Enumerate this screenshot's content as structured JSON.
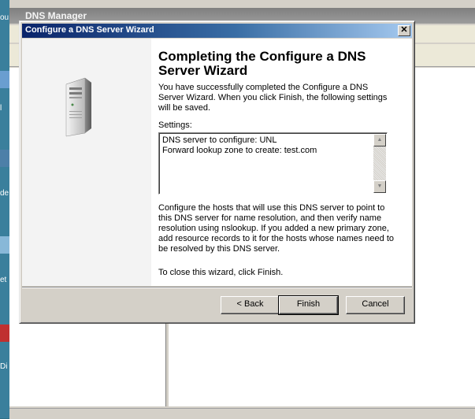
{
  "background_app": {
    "title": "DNS Manager",
    "desktop_labels": [
      "ou",
      "l",
      "de",
      "et",
      "Di"
    ]
  },
  "wizard": {
    "window_title": "Configure a DNS Server Wizard",
    "close_glyph": "✕",
    "heading": "Completing the Configure a DNS Server Wizard",
    "intro": "You have successfully completed the Configure a DNS Server Wizard. When you click Finish, the following settings will be saved.",
    "settings_label": "Settings:",
    "settings_lines": [
      "DNS server to configure: UNL",
      "Forward lookup zone to create: test.com"
    ],
    "instructions": "Configure the hosts that will use this DNS server to point to this DNS server for name resolution, and then verify name resolution using nslookup. If you added a new primary zone, add resource records to it for the hosts whose names need to be resolved by this DNS server.",
    "close_note": "To close this wizard, click Finish.",
    "buttons": {
      "back": "< Back",
      "finish": "Finish",
      "cancel": "Cancel"
    },
    "icons": {
      "server": "server-tower-icon",
      "scroll_up": "scroll-up-arrow-icon",
      "scroll_down": "scroll-down-arrow-icon"
    }
  },
  "colors": {
    "title_bar_start": "#0a246a",
    "title_bar_end": "#a6caf0",
    "dialog_face": "#d4d0c8",
    "desktop": "#2f6f86"
  }
}
